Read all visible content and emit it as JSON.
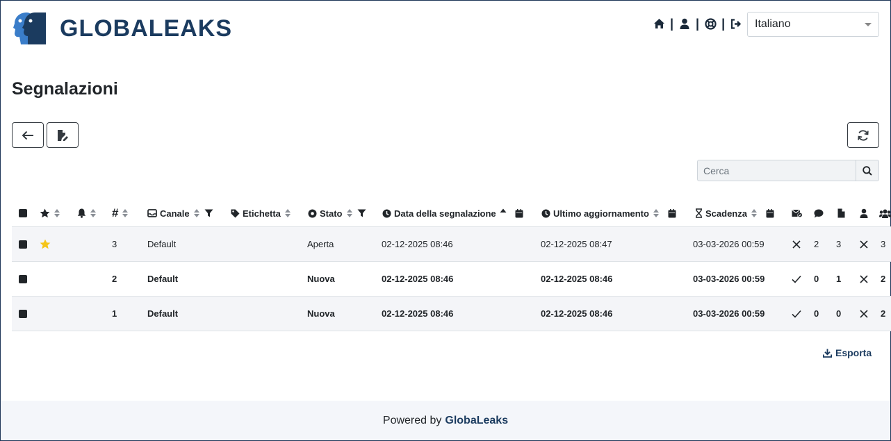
{
  "header": {
    "logo_text": "GLOBALEAKS",
    "nav_separator": "|",
    "language": "Italiano"
  },
  "page": {
    "title": "Segnalazioni"
  },
  "search": {
    "placeholder": "Cerca"
  },
  "table": {
    "columns": {
      "num": "#",
      "channel": "Canale",
      "label": "Etichetta",
      "status": "Stato",
      "report_date": "Data della segnalazione",
      "last_update": "Ultimo aggiornamento",
      "expiry": "Scadenza"
    },
    "rows": [
      {
        "num": "3",
        "channel": "Default",
        "status": "Aperta",
        "report_date": "02-12-2025 08:46",
        "last_update": "02-12-2025 08:47",
        "expiry": "03-03-2026 00:59",
        "comments": "2",
        "files": "3",
        "recipients": "3",
        "starred": true,
        "read": false,
        "bold": false
      },
      {
        "num": "2",
        "channel": "Default",
        "status": "Nuova",
        "report_date": "02-12-2025 08:46",
        "last_update": "02-12-2025 08:46",
        "expiry": "03-03-2026 00:59",
        "comments": "0",
        "files": "1",
        "recipients": "2",
        "starred": false,
        "read": true,
        "bold": true
      },
      {
        "num": "1",
        "channel": "Default",
        "status": "Nuova",
        "report_date": "02-12-2025 08:46",
        "last_update": "02-12-2025 08:46",
        "expiry": "03-03-2026 00:59",
        "comments": "0",
        "files": "0",
        "recipients": "2",
        "starred": false,
        "read": true,
        "bold": true
      }
    ]
  },
  "export_label": "Esporta",
  "footer": {
    "prefix": "Powered by",
    "brand": "GlobaLeaks"
  },
  "colors": {
    "brand": "#1b3b5f",
    "logo_light": "#3a7dc9",
    "star": "#f5c518"
  },
  "icons": {
    "home": "home-icon",
    "user": "user-icon",
    "support": "lifebuoy-icon",
    "logout": "logout-icon",
    "back": "arrow-left-icon",
    "edit_file": "file-edit-icon",
    "refresh": "refresh-icon",
    "search": "search-icon",
    "star": "star-icon",
    "bell": "bell-icon",
    "inbox": "inbox-icon",
    "tag": "tag-icon",
    "status": "circle-dot-icon",
    "clock": "clock-icon",
    "hourglass": "hourglass-icon",
    "calendar": "calendar-icon",
    "filter": "filter-icon",
    "sort": "sort-icon",
    "envelope": "envelope-check-icon",
    "comment": "comment-icon",
    "file": "file-icon",
    "people": "users-icon",
    "download": "download-icon"
  }
}
